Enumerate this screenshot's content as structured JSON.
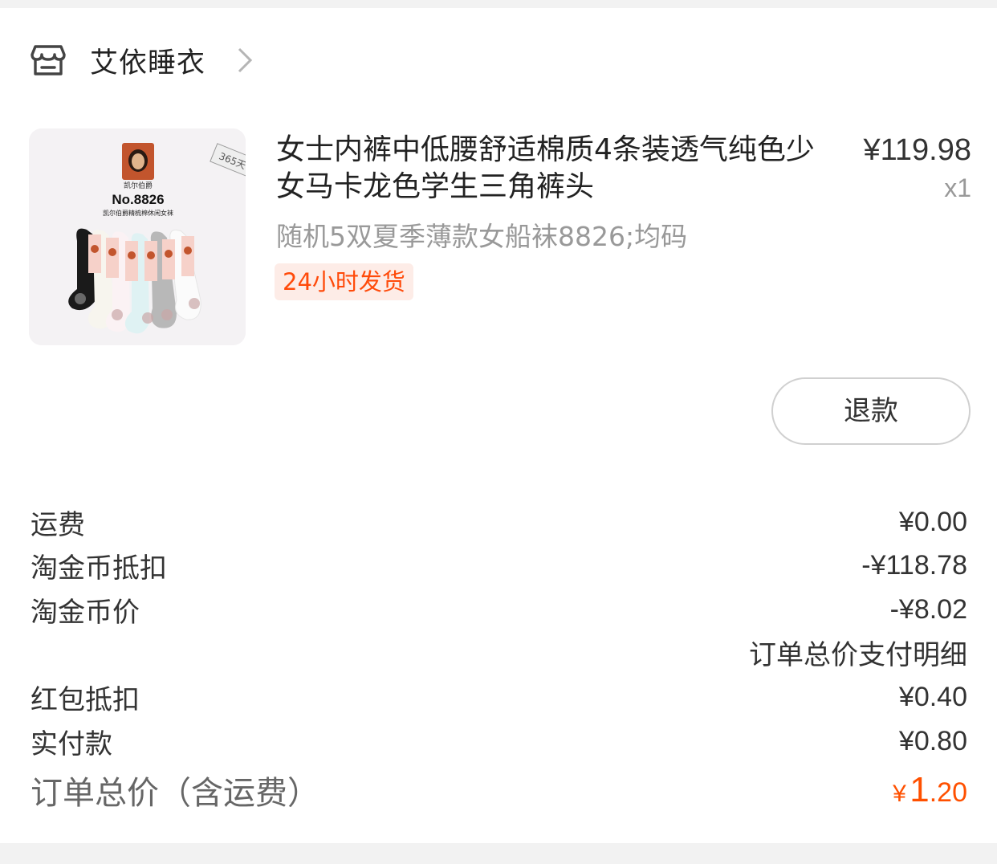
{
  "shop": {
    "name": "艾依睡衣",
    "icon": "store-icon"
  },
  "item": {
    "title": "女士内裤中低腰舒适棉质4条装透气纯色少女马卡龙色学生三角裤头",
    "price": "¥119.98",
    "qty": "x1",
    "sku": "随机5双夏季薄款女船袜8826;均码",
    "tag": "24小时发货",
    "image": {
      "brand": "凯尔伯爵",
      "model": "No.8826",
      "subtitle": "凯尔伯爵精梳棉休闲女袜",
      "badge": "365天",
      "sock_colors": [
        "#1a1a1a",
        "#f7f5ee",
        "#fbf2f4",
        "#dff2f3",
        "#b8b8b8",
        "#fbfbfb"
      ]
    }
  },
  "actions": {
    "refund_label": "退款"
  },
  "fees": [
    {
      "label": "运费",
      "value": "¥0.00"
    },
    {
      "label": "淘金币抵扣",
      "value": "-¥118.78"
    },
    {
      "label": "淘金币价",
      "value": "-¥8.02"
    }
  ],
  "fee_note": "订单总价支付明细",
  "payments": [
    {
      "label": "红包抵扣",
      "value": "¥0.40"
    },
    {
      "label": "实付款",
      "value": "¥0.80"
    }
  ],
  "total": {
    "label": "订单总价（含运费）",
    "symbol": "¥",
    "integer": "1",
    "decimal": ".20"
  },
  "colors": {
    "accent": "#ff5000",
    "tag_bg": "#fdece7",
    "tag_text": "#ff4a0a"
  }
}
